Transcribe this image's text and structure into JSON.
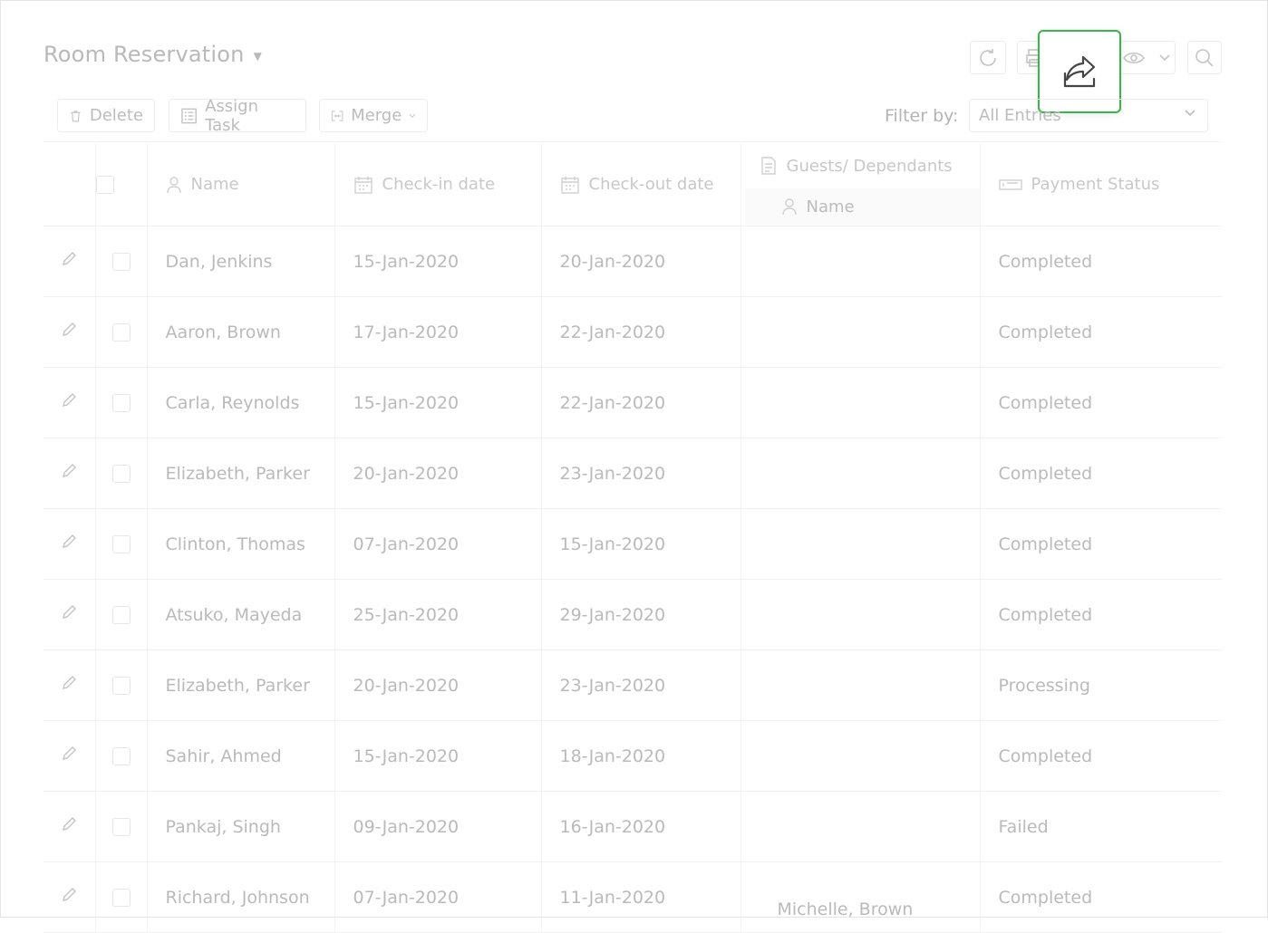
{
  "header": {
    "title": "Room Reservation"
  },
  "toolbar": {
    "delete_label": "Delete",
    "assign_task_label": "Assign Task",
    "merge_label": "Merge",
    "filter_label": "Filter by:",
    "filter_value": "All Entries"
  },
  "table": {
    "columns": {
      "name": "Name",
      "checkin": "Check-in date",
      "checkout": "Check-out date",
      "guests": "Guests/ Dependants",
      "guests_name": "Name",
      "payment": "Payment Status"
    },
    "rows": [
      {
        "name": "Dan, Jenkins",
        "checkin": "15-Jan-2020",
        "checkout": "20-Jan-2020",
        "guest": "",
        "payment": "Completed"
      },
      {
        "name": "Aaron, Brown",
        "checkin": "17-Jan-2020",
        "checkout": "22-Jan-2020",
        "guest": "",
        "payment": "Completed"
      },
      {
        "name": "Carla, Reynolds",
        "checkin": "15-Jan-2020",
        "checkout": "22-Jan-2020",
        "guest": "",
        "payment": "Completed"
      },
      {
        "name": "Elizabeth, Parker",
        "checkin": "20-Jan-2020",
        "checkout": "23-Jan-2020",
        "guest": "",
        "payment": "Completed"
      },
      {
        "name": "Clinton, Thomas",
        "checkin": "07-Jan-2020",
        "checkout": "15-Jan-2020",
        "guest": "",
        "payment": "Completed"
      },
      {
        "name": "Atsuko, Mayeda",
        "checkin": "25-Jan-2020",
        "checkout": "29-Jan-2020",
        "guest": "",
        "payment": "Completed"
      },
      {
        "name": "Elizabeth, Parker",
        "checkin": "20-Jan-2020",
        "checkout": "23-Jan-2020",
        "guest": "",
        "payment": "Processing"
      },
      {
        "name": "Sahir, Ahmed",
        "checkin": "15-Jan-2020",
        "checkout": "18-Jan-2020",
        "guest": "",
        "payment": "Completed"
      },
      {
        "name": "Pankaj, Singh",
        "checkin": "09-Jan-2020",
        "checkout": "16-Jan-2020",
        "guest": "",
        "payment": "Failed"
      },
      {
        "name": "Richard, Johnson",
        "checkin": "07-Jan-2020",
        "checkout": "11-Jan-2020",
        "guest": "Michelle, Brown",
        "payment": "Completed"
      }
    ]
  },
  "colors": {
    "highlight_border": "#39b54a",
    "faded_text": "#bababa"
  }
}
